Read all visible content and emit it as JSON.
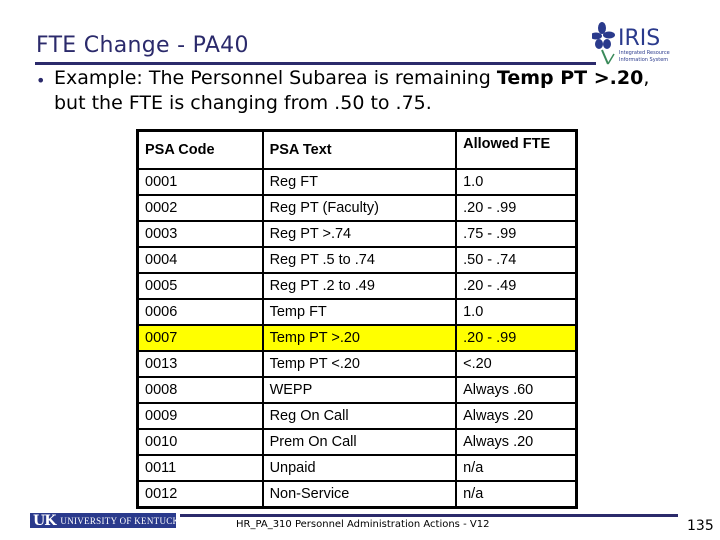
{
  "slide": {
    "title": "FTE Change - PA40",
    "bullet": {
      "text_before": "Example:  The Personnel Subarea is remaining ",
      "bold": "Temp PT >.20",
      "text_after": ", but the FTE is changing from .50 to .75."
    }
  },
  "logos": {
    "iris": {
      "name": "IRIS",
      "tagline_line1": "Integrated Resource",
      "tagline_line2": "Information System"
    },
    "uk": {
      "mark": "UK",
      "name": "UNIVERSITY OF KENTUCKY"
    }
  },
  "colors": {
    "title": "#2b2a6b",
    "highlight": "#ffff00",
    "uk_blue": "#2a3a8c"
  },
  "table": {
    "headers": [
      "PSA Code",
      "PSA Text",
      "Allowed FTE"
    ],
    "rows": [
      {
        "code": "0001",
        "text": "Reg FT",
        "fte": "1.0",
        "highlight": false
      },
      {
        "code": "0002",
        "text": "Reg PT (Faculty)",
        "fte": ".20 - .99",
        "highlight": false
      },
      {
        "code": "0003",
        "text": "Reg PT >.74",
        "fte": ".75 - .99",
        "highlight": false
      },
      {
        "code": "0004",
        "text": "Reg PT .5 to .74",
        "fte": ".50 - .74",
        "highlight": false
      },
      {
        "code": "0005",
        "text": "Reg PT .2 to .49",
        "fte": ".20 - .49",
        "highlight": false
      },
      {
        "code": "0006",
        "text": "Temp FT",
        "fte": "1.0",
        "highlight": false
      },
      {
        "code": "0007",
        "text": "Temp PT >.20",
        "fte": ".20 - .99",
        "highlight": true
      },
      {
        "code": "0013",
        "text": "Temp PT <.20",
        "fte": " <.20",
        "highlight": false
      },
      {
        "code": "0008",
        "text": "WEPP",
        "fte": "Always .60",
        "highlight": false
      },
      {
        "code": "0009",
        "text": "Reg On Call",
        "fte": "Always .20",
        "highlight": false
      },
      {
        "code": "0010",
        "text": "Prem On Call",
        "fte": "Always .20",
        "highlight": false
      },
      {
        "code": "0011",
        "text": "Unpaid",
        "fte": "n/a",
        "highlight": false
      },
      {
        "code": "0012",
        "text": "Non-Service",
        "fte": "n/a",
        "highlight": false
      }
    ]
  },
  "footer": {
    "course": "HR_PA_310 Personnel Administration Actions - V12",
    "page_number": "135"
  }
}
